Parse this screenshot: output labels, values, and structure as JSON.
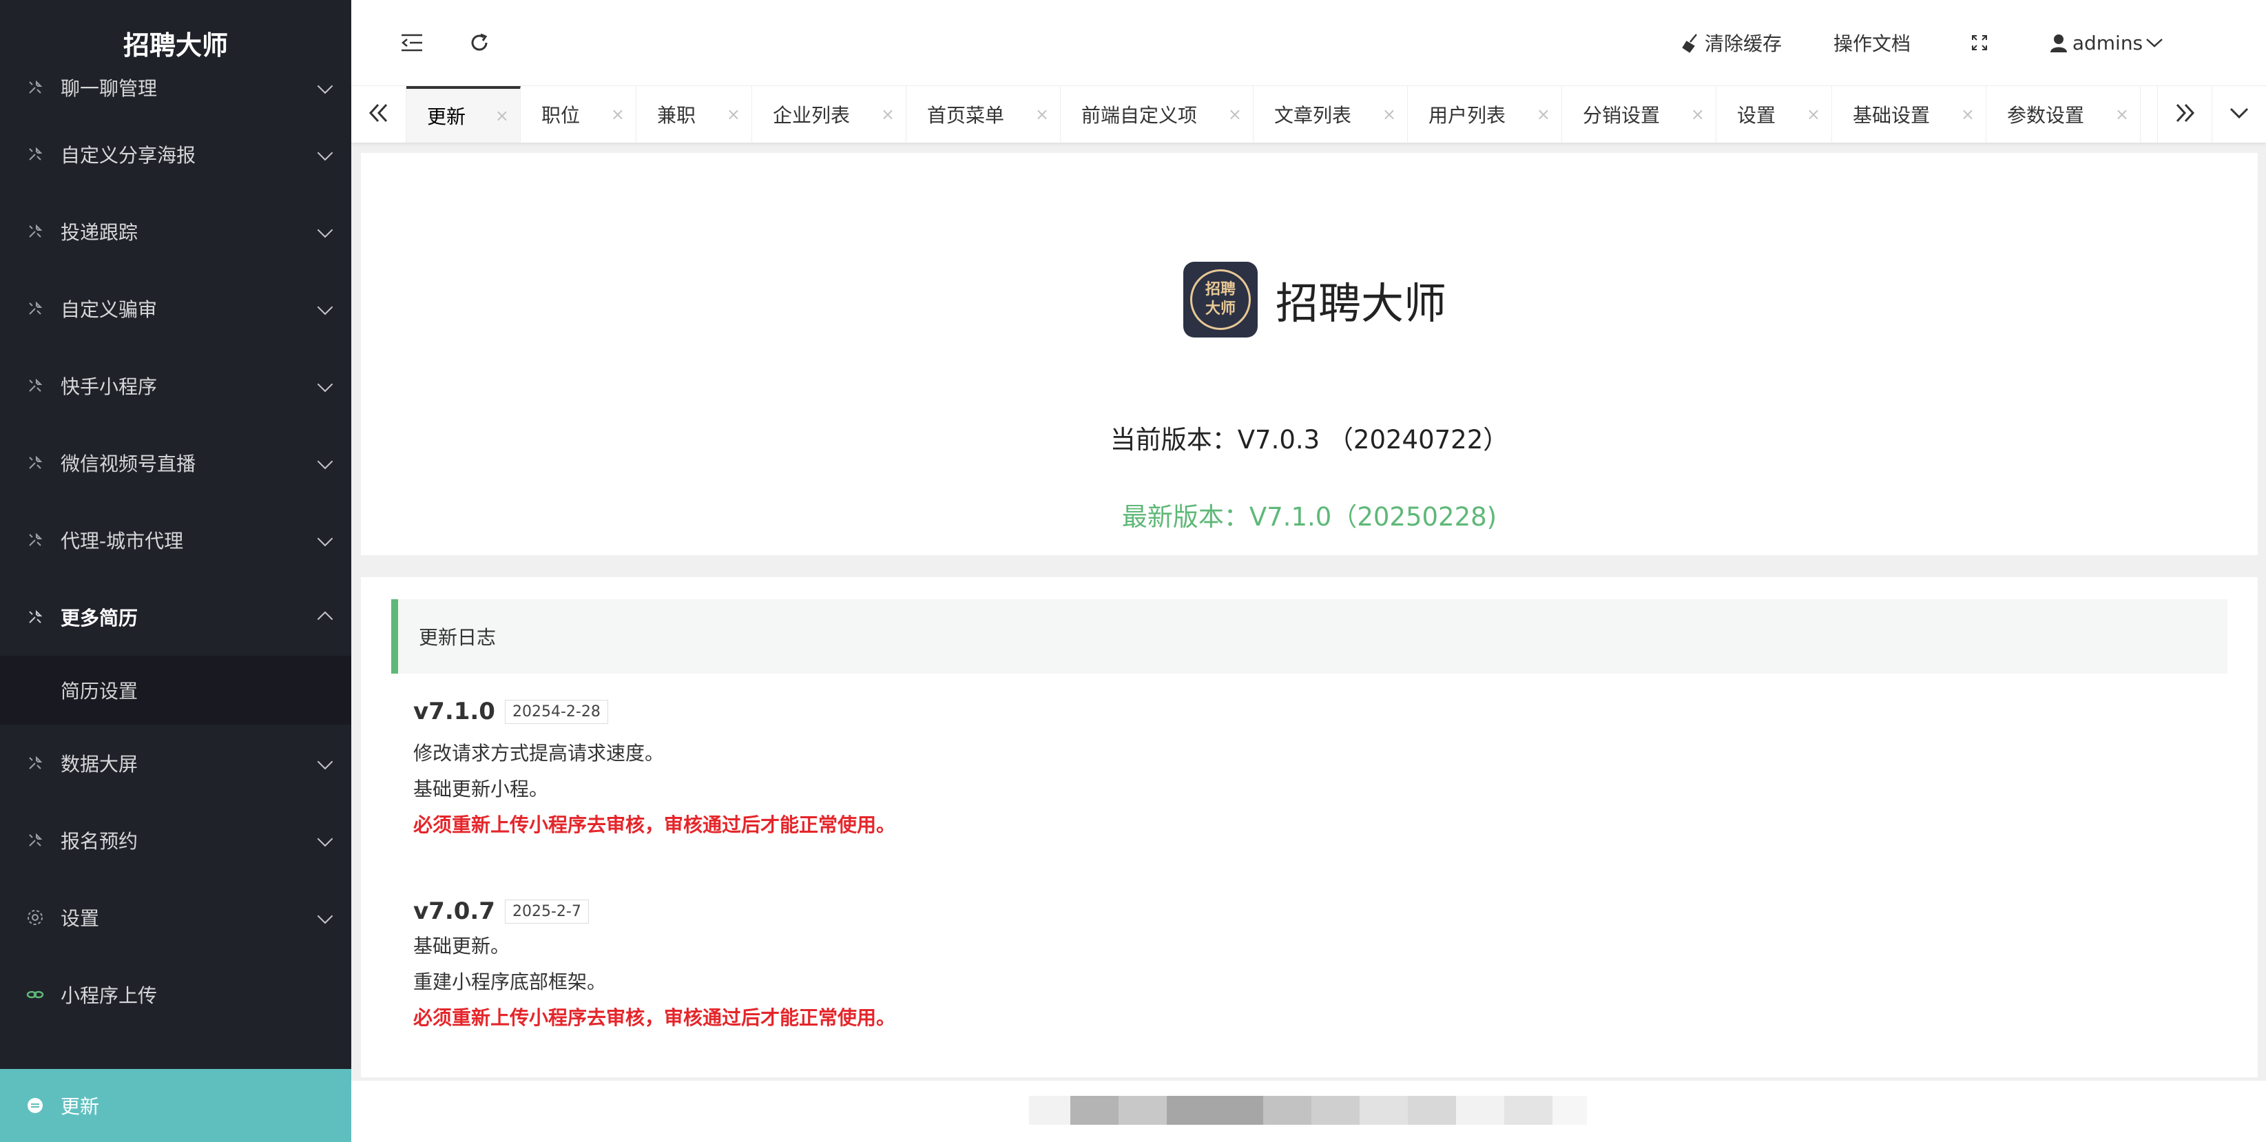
{
  "sidebar": {
    "brand": "招聘大师",
    "items": [
      {
        "label": "聊一聊管理",
        "icon": "tools-icon"
      },
      {
        "label": "自定义分享海报",
        "icon": "tools-icon"
      },
      {
        "label": "投递跟踪",
        "icon": "tools-icon"
      },
      {
        "label": "自定义骗审",
        "icon": "tools-icon"
      },
      {
        "label": "快手小程序",
        "icon": "tools-icon"
      },
      {
        "label": "微信视频号直播",
        "icon": "tools-icon"
      },
      {
        "label": "代理-城市代理",
        "icon": "tools-icon"
      },
      {
        "label": "更多简历",
        "icon": "tools-icon",
        "expanded": true
      }
    ],
    "subitems": [
      {
        "label": "简历设置"
      }
    ],
    "items_after": [
      {
        "label": "数据大屏",
        "icon": "tools-icon"
      },
      {
        "label": "报名预约",
        "icon": "tools-icon"
      },
      {
        "label": "设置",
        "icon": "gear-icon"
      },
      {
        "label": "小程序上传",
        "icon": "link-icon"
      }
    ],
    "active_item": {
      "label": "更新",
      "icon": "circle-icon"
    },
    "colors": {
      "bg": "#20222a",
      "active": "#5fbfbf"
    }
  },
  "header": {
    "clear_cache": "清除缓存",
    "docs": "操作文档",
    "user": "admins"
  },
  "tabs": [
    {
      "label": "更新",
      "active": true
    },
    {
      "label": "职位"
    },
    {
      "label": "兼职"
    },
    {
      "label": "企业列表"
    },
    {
      "label": "首页菜单"
    },
    {
      "label": "前端自定义项"
    },
    {
      "label": "文章列表"
    },
    {
      "label": "用户列表"
    },
    {
      "label": "分销设置"
    },
    {
      "label": "设置"
    },
    {
      "label": "基础设置"
    },
    {
      "label": "参数设置"
    }
  ],
  "tab_close_glyph": "×",
  "main": {
    "logo_text_line1": "招聘",
    "logo_text_line2": "大师",
    "brand_name": "招聘大师",
    "current_version": "当前版本：V7.0.3 （20240722）",
    "latest_version": "最新版本：V7.1.0（20250228)",
    "colors": {
      "latest": "#5fb878",
      "warning": "#e4262b"
    }
  },
  "changelog": {
    "title": "更新日志",
    "entries": [
      {
        "version": "v7.1.0",
        "date": "20254-2-28",
        "lines": [
          "修改请求方式提高请求速度。",
          "基础更新小程。"
        ],
        "warning": "必须重新上传小程序去审核，审核通过后才能正常使用。"
      },
      {
        "version": "v7.0.7",
        "date": "2025-2-7",
        "lines": [
          "基础更新。",
          "重建小程序底部框架。"
        ],
        "warning": "必须重新上传小程序去审核，审核通过后才能正常使用。"
      }
    ]
  }
}
